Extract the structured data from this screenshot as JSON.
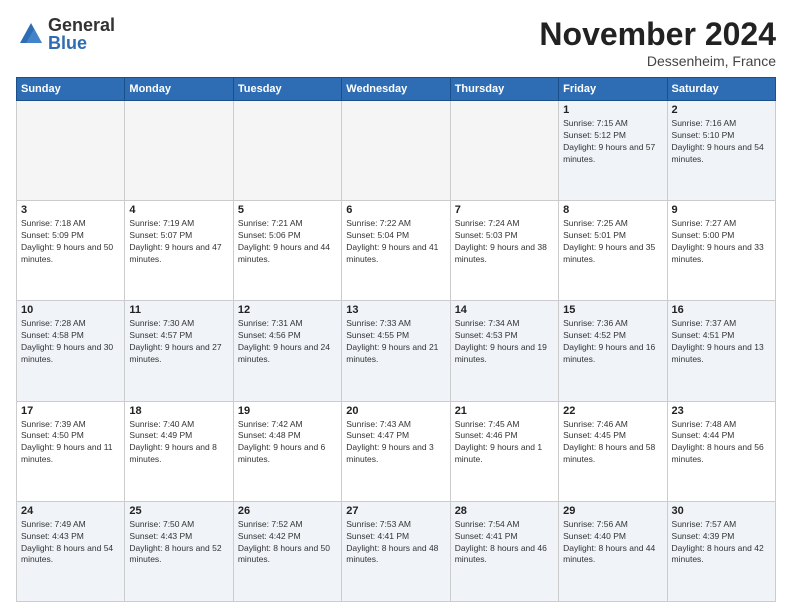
{
  "logo": {
    "general": "General",
    "blue": "Blue"
  },
  "title": "November 2024",
  "location": "Dessenheim, France",
  "weekdays": [
    "Sunday",
    "Monday",
    "Tuesday",
    "Wednesday",
    "Thursday",
    "Friday",
    "Saturday"
  ],
  "weeks": [
    [
      {
        "day": "",
        "empty": true
      },
      {
        "day": "",
        "empty": true
      },
      {
        "day": "",
        "empty": true
      },
      {
        "day": "",
        "empty": true
      },
      {
        "day": "",
        "empty": true
      },
      {
        "day": "1",
        "sunrise": "7:15 AM",
        "sunset": "5:12 PM",
        "daylight": "9 hours and 57 minutes."
      },
      {
        "day": "2",
        "sunrise": "7:16 AM",
        "sunset": "5:10 PM",
        "daylight": "9 hours and 54 minutes."
      }
    ],
    [
      {
        "day": "3",
        "sunrise": "7:18 AM",
        "sunset": "5:09 PM",
        "daylight": "9 hours and 50 minutes."
      },
      {
        "day": "4",
        "sunrise": "7:19 AM",
        "sunset": "5:07 PM",
        "daylight": "9 hours and 47 minutes."
      },
      {
        "day": "5",
        "sunrise": "7:21 AM",
        "sunset": "5:06 PM",
        "daylight": "9 hours and 44 minutes."
      },
      {
        "day": "6",
        "sunrise": "7:22 AM",
        "sunset": "5:04 PM",
        "daylight": "9 hours and 41 minutes."
      },
      {
        "day": "7",
        "sunrise": "7:24 AM",
        "sunset": "5:03 PM",
        "daylight": "9 hours and 38 minutes."
      },
      {
        "day": "8",
        "sunrise": "7:25 AM",
        "sunset": "5:01 PM",
        "daylight": "9 hours and 35 minutes."
      },
      {
        "day": "9",
        "sunrise": "7:27 AM",
        "sunset": "5:00 PM",
        "daylight": "9 hours and 33 minutes."
      }
    ],
    [
      {
        "day": "10",
        "sunrise": "7:28 AM",
        "sunset": "4:58 PM",
        "daylight": "9 hours and 30 minutes."
      },
      {
        "day": "11",
        "sunrise": "7:30 AM",
        "sunset": "4:57 PM",
        "daylight": "9 hours and 27 minutes."
      },
      {
        "day": "12",
        "sunrise": "7:31 AM",
        "sunset": "4:56 PM",
        "daylight": "9 hours and 24 minutes."
      },
      {
        "day": "13",
        "sunrise": "7:33 AM",
        "sunset": "4:55 PM",
        "daylight": "9 hours and 21 minutes."
      },
      {
        "day": "14",
        "sunrise": "7:34 AM",
        "sunset": "4:53 PM",
        "daylight": "9 hours and 19 minutes."
      },
      {
        "day": "15",
        "sunrise": "7:36 AM",
        "sunset": "4:52 PM",
        "daylight": "9 hours and 16 minutes."
      },
      {
        "day": "16",
        "sunrise": "7:37 AM",
        "sunset": "4:51 PM",
        "daylight": "9 hours and 13 minutes."
      }
    ],
    [
      {
        "day": "17",
        "sunrise": "7:39 AM",
        "sunset": "4:50 PM",
        "daylight": "9 hours and 11 minutes."
      },
      {
        "day": "18",
        "sunrise": "7:40 AM",
        "sunset": "4:49 PM",
        "daylight": "9 hours and 8 minutes."
      },
      {
        "day": "19",
        "sunrise": "7:42 AM",
        "sunset": "4:48 PM",
        "daylight": "9 hours and 6 minutes."
      },
      {
        "day": "20",
        "sunrise": "7:43 AM",
        "sunset": "4:47 PM",
        "daylight": "9 hours and 3 minutes."
      },
      {
        "day": "21",
        "sunrise": "7:45 AM",
        "sunset": "4:46 PM",
        "daylight": "9 hours and 1 minute."
      },
      {
        "day": "22",
        "sunrise": "7:46 AM",
        "sunset": "4:45 PM",
        "daylight": "8 hours and 58 minutes."
      },
      {
        "day": "23",
        "sunrise": "7:48 AM",
        "sunset": "4:44 PM",
        "daylight": "8 hours and 56 minutes."
      }
    ],
    [
      {
        "day": "24",
        "sunrise": "7:49 AM",
        "sunset": "4:43 PM",
        "daylight": "8 hours and 54 minutes."
      },
      {
        "day": "25",
        "sunrise": "7:50 AM",
        "sunset": "4:43 PM",
        "daylight": "8 hours and 52 minutes."
      },
      {
        "day": "26",
        "sunrise": "7:52 AM",
        "sunset": "4:42 PM",
        "daylight": "8 hours and 50 minutes."
      },
      {
        "day": "27",
        "sunrise": "7:53 AM",
        "sunset": "4:41 PM",
        "daylight": "8 hours and 48 minutes."
      },
      {
        "day": "28",
        "sunrise": "7:54 AM",
        "sunset": "4:41 PM",
        "daylight": "8 hours and 46 minutes."
      },
      {
        "day": "29",
        "sunrise": "7:56 AM",
        "sunset": "4:40 PM",
        "daylight": "8 hours and 44 minutes."
      },
      {
        "day": "30",
        "sunrise": "7:57 AM",
        "sunset": "4:39 PM",
        "daylight": "8 hours and 42 minutes."
      }
    ]
  ]
}
